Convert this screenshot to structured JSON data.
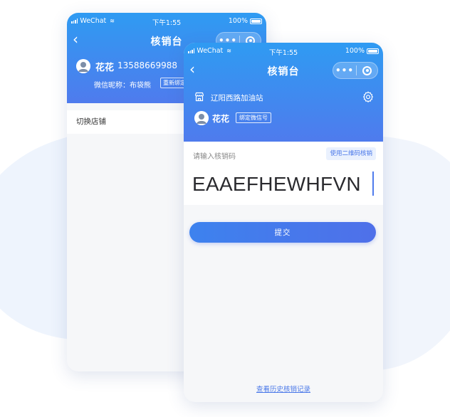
{
  "status_bar": {
    "carrier": "WeChat",
    "time": "下午1:55",
    "battery": "100%"
  },
  "back_screen": {
    "nav_title": "核销台",
    "user_name": "花花",
    "user_phone": "13588669988",
    "wechat_nickname": "微信昵称：布袋熊",
    "rebind_label": "重新绑定",
    "switch_store_label": "切换店铺"
  },
  "front_screen": {
    "nav_title": "核销台",
    "store_name": "辽阳西路加油站",
    "user_name": "花花",
    "bind_wechat_label": "绑定微信号",
    "code_prompt": "请输入核销码",
    "qr_button_label": "使用二维码核销",
    "code_value": "EAAEFHEWHFVN",
    "submit_label": "提交",
    "history_link": "查看历史核销记录"
  },
  "icons": {
    "back": "chevron-left-icon",
    "more": "more-dots-icon",
    "close_miniapp": "target-icon",
    "store": "store-icon",
    "settings": "gear-icon",
    "avatar": "user-avatar"
  },
  "colors": {
    "header_top": "#2f9bf2",
    "header_bottom": "#4f7bed",
    "accent": "#4a78e9",
    "page_bg": "#f6f7f9"
  }
}
